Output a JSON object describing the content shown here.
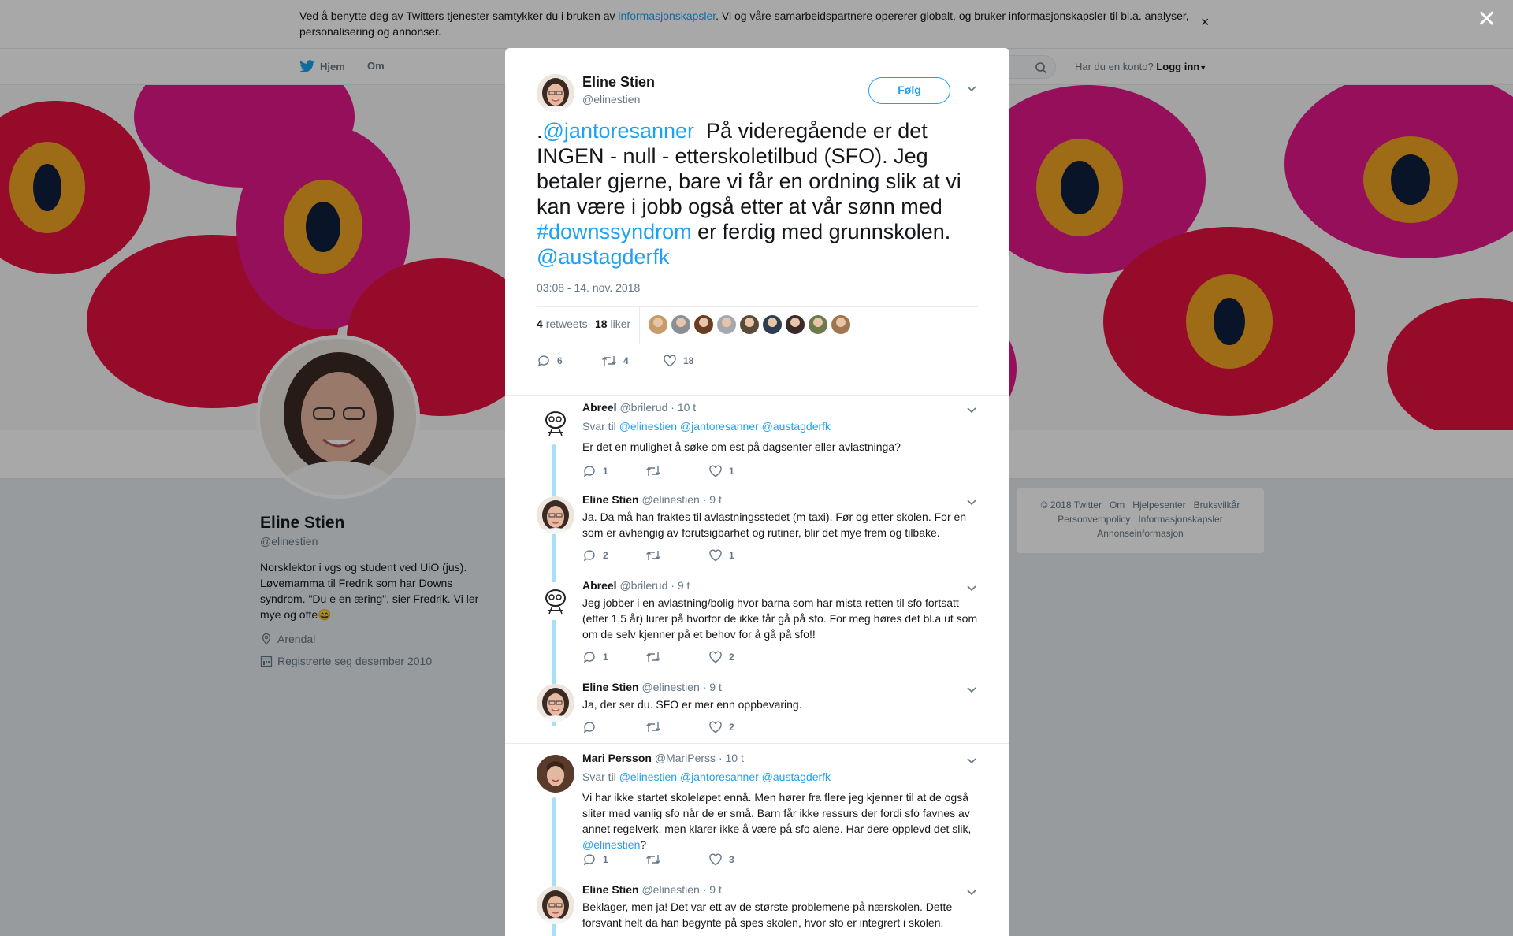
{
  "cookie": {
    "text_before": "Ved å benytte deg av Twitters tjenester samtykker du i bruken av ",
    "link": "informasjonskapsler",
    "text_after": ". Vi og våre samarbeidspartnere opererer globalt, og bruker informasjonskapsler til bl.a. analyser, personalisering og annonser."
  },
  "nav": {
    "home": "Hjem",
    "about": "Om",
    "login_question": "Har du en konto?",
    "login": "Logg inn"
  },
  "profile": {
    "name": "Eline Stien",
    "handle": "@elinestien",
    "bio": "Norsklektor i vgs og student ved UiO (jus). Løvemamma til Fredrik som har Downs syndrom. \"Du e en æring\", sier Fredrik. Vi ler mye og ofte😄",
    "location": "Arendal",
    "joined": "Registrerte seg desember 2010"
  },
  "footer": {
    "links": [
      "© 2018 Twitter",
      "Om",
      "Hjelpesenter",
      "Bruksvilkår",
      "Personvernpolicy",
      "Informasjonskapsler",
      "Annonseinformasjon"
    ]
  },
  "tweet": {
    "name": "Eline Stien",
    "handle": "@elinestien",
    "follow": "Følg",
    "text_prefix": ".",
    "mention1": "@jantoresanner",
    "text_mid": "  På videregående er det INGEN - null - etterskoletilbud (SFO). Jeg betaler gjerne, bare vi får en ordning slik at vi kan være i jobb også etter at vår sønn med ",
    "hashtag": "#downssyndrom",
    "text_end": " er ferdig med grunnskolen. ",
    "mention2": "@austagderfk",
    "time": "03:08 - 14. nov. 2018",
    "retweets_count": "4",
    "retweets_label": "retweets",
    "likes_count": "18",
    "likes_label": "liker",
    "liker_colors": [
      "#c89b6a",
      "#8a8f96",
      "#6b3d20",
      "#a5a9ad",
      "#5a4a3a",
      "#2c3e50",
      "#3a2a2a",
      "#6d7a4a",
      "#a0764e"
    ],
    "replies": "6",
    "retweets": "4",
    "likes": "18"
  },
  "replies": [
    {
      "name": "Abreel",
      "handle": "@brilerud",
      "time": "· 10 t",
      "reply_to_label": "Svar til",
      "reply_to": "@elinestien @jantoresanner @austagderfk",
      "text": "Er det en mulighet å søke om est på dagsenter eller avlastninga?",
      "replies": "1",
      "retweets": "",
      "likes": "1",
      "avatar": "doodle"
    },
    {
      "name": "Eline Stien",
      "handle": "@elinestien",
      "time": "· 9 t",
      "text": "Ja. Da må han fraktes til avlastningsstedet (m taxi). Før og etter skolen. For en som er avhengig av forutsigbarhet og rutiner, blir det mye frem og tilbake.",
      "replies": "2",
      "retweets": "",
      "likes": "1",
      "avatar": "eline"
    },
    {
      "name": "Abreel",
      "handle": "@brilerud",
      "time": "· 9 t",
      "text": "Jeg jobber i en avlastning/bolig hvor barna som har mista retten til sfo fortsatt (etter 1,5 år) lurer på hvorfor de ikke får gå på sfo. For meg høres det bl.a ut som om de selv kjenner på et behov for å gå på sfo!!",
      "replies": "1",
      "retweets": "",
      "likes": "2",
      "avatar": "doodle"
    },
    {
      "name": "Eline Stien",
      "handle": "@elinestien",
      "time": "· 9 t",
      "text": "Ja, der ser du. SFO er mer enn oppbevaring.",
      "replies": "",
      "retweets": "",
      "likes": "2",
      "avatar": "eline"
    },
    {
      "name": "Mari Persson",
      "handle": "@MariPerss",
      "time": "· 10 t",
      "reply_to_label": "Svar til",
      "reply_to": "@elinestien @jantoresanner @austagderfk",
      "text": "Vi har ikke startet skoleløpet ennå. Men hører fra flere jeg kjenner til at de også sliter med vanlig sfo når de er små. Barn får ikke ressurs der fordi sfo favnes av annet regelverk, men klarer ikke å være på sfo alene. Har dere opplevd det slik, ",
      "text_mention": "@elinestien",
      "text_tail": "?",
      "replies": "1",
      "retweets": "",
      "likes": "3",
      "avatar": "mari"
    },
    {
      "name": "Eline Stien",
      "handle": "@elinestien",
      "time": "· 9 t",
      "text": "Beklager, men ja! Det var ett av de største problemene på nærskolen. Dette forsvant helt da han begynte på spes skolen, hvor sfo er integrert i skolen.",
      "avatar": "eline"
    }
  ]
}
